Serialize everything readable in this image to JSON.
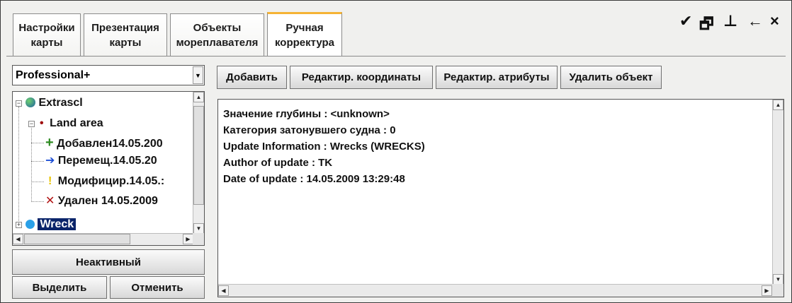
{
  "tabs": [
    {
      "line1": "Настройки",
      "line2": "карты"
    },
    {
      "line1": "Презентация",
      "line2": "карты"
    },
    {
      "line1": "Объекты",
      "line2": "мореплавателя"
    },
    {
      "line1": "Ручная",
      "line2": "корректура",
      "active": true
    }
  ],
  "titlebar": {
    "brush_icon": "✔",
    "window_icon": "🗗",
    "pin_icon": "⊥",
    "back_icon": "←",
    "close_icon": "×"
  },
  "combo": {
    "value": "Professional+"
  },
  "tree": {
    "root": "Extrascl",
    "child": "Land area",
    "items": [
      {
        "label": "Добавлен14.05.200",
        "icon": "+",
        "color": "#2e8b22"
      },
      {
        "label": "Перемещ.14.05.20",
        "icon": "➔",
        "color": "#1d4fd6"
      },
      {
        "label": "Модифицир.14.05.:",
        "icon": "!",
        "color": "#e8c300"
      },
      {
        "label": "Удален 14.05.2009",
        "icon": "✕",
        "color": "#b11313"
      }
    ],
    "selected": "Wreck"
  },
  "left_buttons": {
    "inactive": "Неактивный",
    "select": "Выделить",
    "cancel": "Отменить"
  },
  "toolbar": {
    "add": "Добавить",
    "edit_coords": "Редактир. координаты",
    "edit_attrs": "Редактир. атрибуты",
    "delete": "Удалить объект"
  },
  "info_lines": [
    "Значение глубины : <unknown>",
    "Категория затонувшего судна : 0",
    "Update Information : Wrecks (WRECKS)",
    "Author of update : TK",
    "Date of update : 14.05.2009  13:29:48"
  ]
}
